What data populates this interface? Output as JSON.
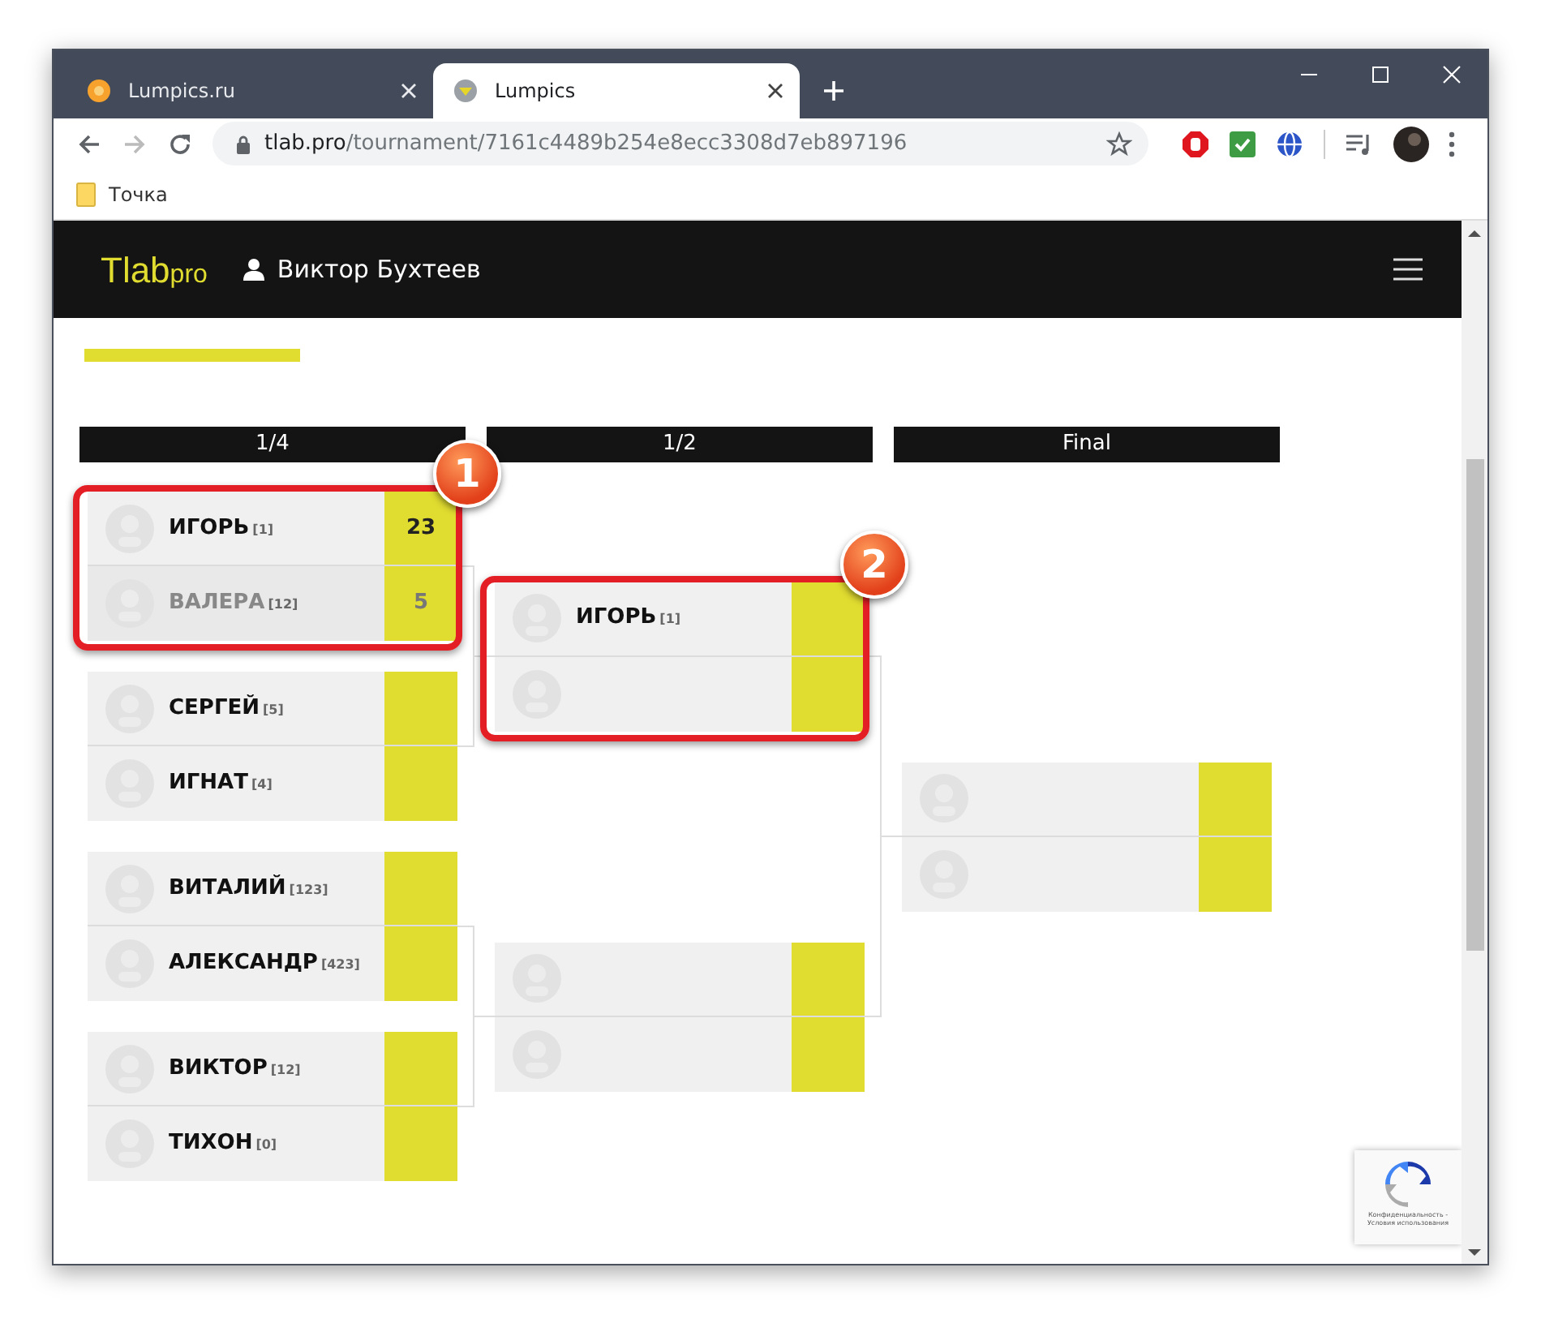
{
  "browser": {
    "tabs": [
      {
        "title": "Lumpics.ru",
        "selected": false
      },
      {
        "title": "Lumpics",
        "selected": true
      }
    ],
    "address": {
      "host": "tlab.pro",
      "path": "/tournament/7161c4489b254e8ecc3308d7eb897196"
    },
    "bookmarks": [
      {
        "label": "Точка"
      }
    ]
  },
  "navbar": {
    "logo": "Tlab",
    "logo_suffix": "pro",
    "user": "Виктор Бухтеев"
  },
  "rounds": [
    {
      "title": "1/4",
      "matches": [
        {
          "callout": "1",
          "players": [
            {
              "kind": "player",
              "name": "ИГОРЬ",
              "seed": "[1]",
              "score": "23",
              "lost": false
            },
            {
              "kind": "player",
              "name": "ВАЛЕРА",
              "seed": "[12]",
              "score": "5",
              "lost": true
            }
          ]
        },
        {
          "players": [
            {
              "kind": "player",
              "name": "СЕРГЕЙ",
              "seed": "[5]"
            },
            {
              "kind": "player",
              "name": "ИГНАТ",
              "seed": "[4]"
            }
          ]
        },
        {
          "players": [
            {
              "kind": "player",
              "name": "ВИТАЛИЙ",
              "seed": "[123]"
            },
            {
              "kind": "player",
              "name": "АЛЕКСАНДР",
              "seed": "[423]"
            }
          ]
        },
        {
          "players": [
            {
              "kind": "player",
              "name": "ВИКТОР",
              "seed": "[12]"
            },
            {
              "kind": "player",
              "name": "ТИХОН",
              "seed": "[0]"
            }
          ]
        }
      ]
    },
    {
      "title": "1/2",
      "matches": [
        {
          "callout": "2",
          "players": [
            {
              "kind": "player",
              "name": "ИГОРЬ",
              "seed": "[1]"
            },
            {
              "kind": "empty"
            }
          ]
        },
        {
          "players": [
            {
              "kind": "empty"
            },
            {
              "kind": "empty"
            }
          ]
        }
      ]
    },
    {
      "title": "Final",
      "matches": [
        {
          "players": [
            {
              "kind": "empty"
            },
            {
              "kind": "empty"
            }
          ]
        }
      ]
    }
  ],
  "recaptcha": {
    "text": "Конфиденциальность - Условия использования"
  }
}
